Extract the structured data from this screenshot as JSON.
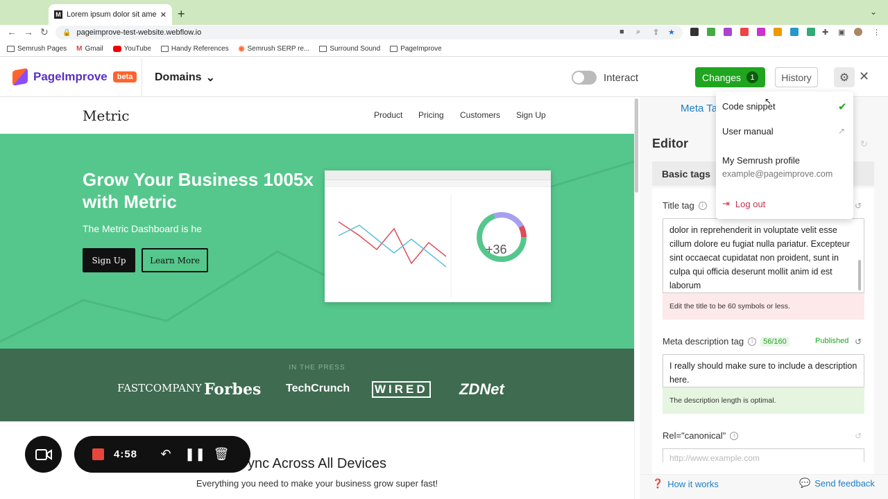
{
  "browser": {
    "tab_title": "Lorem ipsum dolor sit amet, c",
    "tab_favicon": "M",
    "new_tab": "+",
    "url": "pageimprove-test-website.webflow.io",
    "bookmarks": [
      "Semrush Pages",
      "Gmail",
      "YouTube",
      "Handy References",
      "Semrush SERP re...",
      "Surround Sound",
      "PageImprove"
    ]
  },
  "extension": {
    "brand": "PageImprove",
    "badge": "beta",
    "domains_label": "Domains",
    "interact_label": "Interact",
    "changes_label": "Changes",
    "changes_count": "1",
    "history_label": "History"
  },
  "site": {
    "logo": "Metric",
    "nav": [
      "Product",
      "Pricing",
      "Customers",
      "Sign Up"
    ],
    "hero_title": "Grow Your Business 1005x with Metric",
    "hero_subtitle": "The Metric Dashboard is he",
    "signup_label": "Sign Up",
    "learn_label": "Learn More",
    "dashboard_value": "+36",
    "press_label": "IN THE PRESS",
    "press_logos": [
      "FASTCOMPANY",
      "Forbes",
      "TechCrunch",
      "WIRED",
      "ZDNet"
    ],
    "section_title": "ync Across All Devices",
    "section_sub_prefix": "Everything you need to make your business grow ",
    "section_sub_emph": "super fast!"
  },
  "recorder": {
    "time": "4:58"
  },
  "editor": {
    "meta_tab": "Meta Ta",
    "heading": "Editor",
    "basic_tags": "Basic tags",
    "title_label": "Title tag",
    "title_value": "dolor in reprehenderit in voluptate velit esse cillum dolore eu fugiat nulla pariatur. Excepteur sint occaecat cupidatat non proident, sunt in culpa qui officia deserunt mollit anim id est laborum",
    "title_warning": "Edit the title to be 60 symbols or less.",
    "desc_label": "Meta description tag",
    "desc_count": "56/160",
    "desc_status": "Published",
    "desc_value": "I really should make sure to include a description here.",
    "desc_ok": "The description length is optimal.",
    "canonical_label": "Rel=\"canonical\"",
    "canonical_placeholder": "http://www.example.com",
    "how_works": "How it works",
    "send_feedback": "Send feedback"
  },
  "menu": {
    "code_snippet": "Code snippet",
    "user_manual": "User manual",
    "profile": "My Semrush profile",
    "email": "example@pageimprove.com",
    "logout": "Log out"
  },
  "colors": {
    "accent_green": "#1fa51f",
    "hero_green": "#55c78c",
    "brand_purple": "#5a2fc2",
    "brand_orange": "#ff642d"
  }
}
